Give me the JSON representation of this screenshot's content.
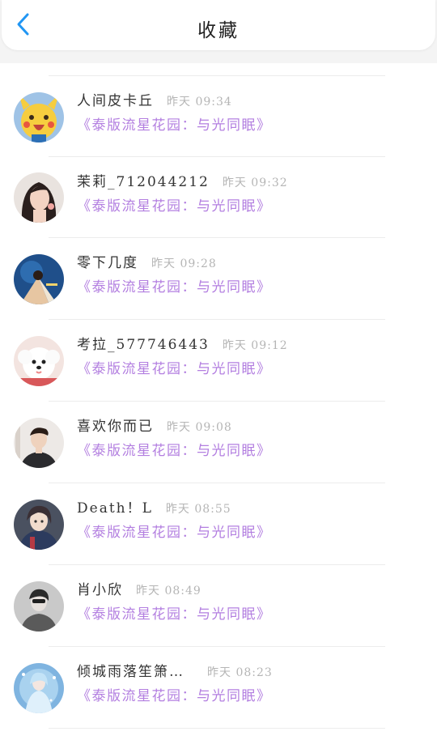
{
  "header": {
    "title": "收藏",
    "back_icon": "chevron-left-icon",
    "accent_color": "#2196f3"
  },
  "list": {
    "link_color": "#b37fe0",
    "items": [
      {
        "name": "人间皮卡丘",
        "time": "昨天 09:34",
        "work": "《泰版流星花园：与光同眠》",
        "avatar": "pikachu-avatar"
      },
      {
        "name": "茉莉_712044212",
        "time": "昨天 09:32",
        "work": "《泰版流星花园：与光同眠》",
        "avatar": "girl-portrait-avatar"
      },
      {
        "name": "零下几度",
        "time": "昨天 09:28",
        "work": "《泰版流星花园：与光同眠》",
        "avatar": "illustration-avatar"
      },
      {
        "name": "考拉_577746443",
        "time": "昨天 09:12",
        "work": "《泰版流星花园：与光同眠》",
        "avatar": "white-dog-avatar"
      },
      {
        "name": "喜欢你而已",
        "time": "昨天 09:08",
        "work": "《泰版流星花园：与光同眠》",
        "avatar": "man-portrait-avatar"
      },
      {
        "name": "Death！L",
        "time": "昨天 08:55",
        "work": "《泰版流星花园：与光同眠》",
        "avatar": "anime-character-avatar"
      },
      {
        "name": "肖小欣",
        "time": "昨天 08:49",
        "work": "《泰版流星花园：与光同眠》",
        "avatar": "grey-portrait-avatar"
      },
      {
        "name": "倾城雨落笙箫…",
        "time": "昨天 08:23",
        "work": "《泰版流星花园：与光同眠》",
        "avatar": "blue-anime-avatar"
      }
    ]
  }
}
